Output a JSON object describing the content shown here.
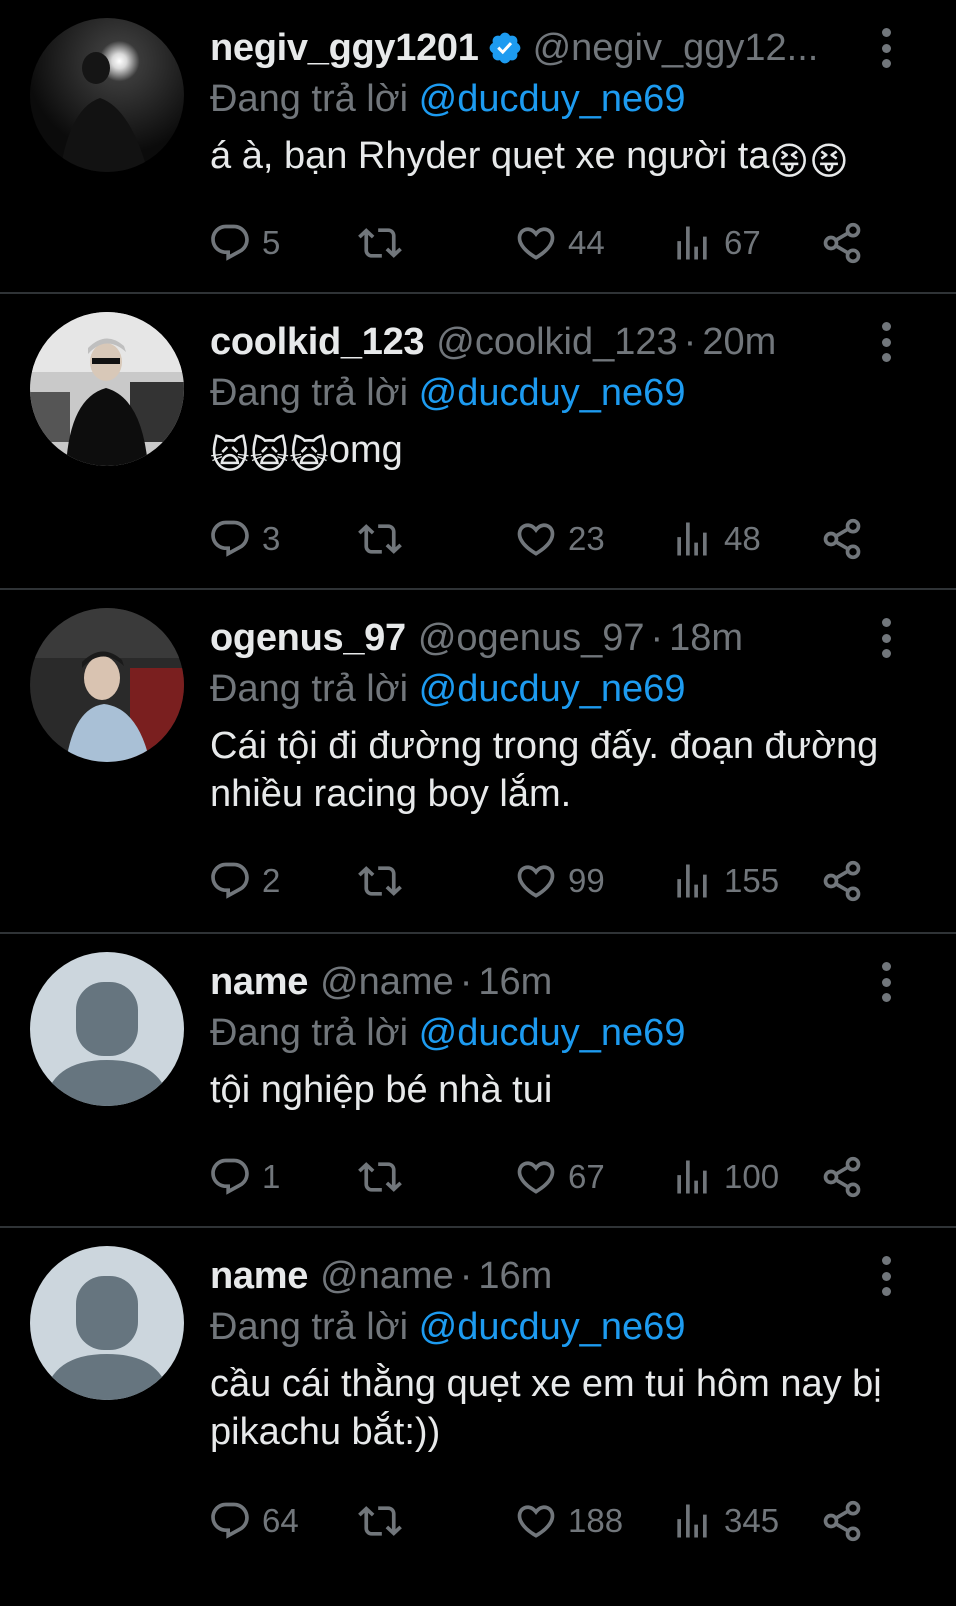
{
  "reply_prefix": "Đang trả lời",
  "tweets": [
    {
      "name": "negiv_ggy1201",
      "verified": true,
      "handle": "@negiv_ggy12...",
      "dot": "",
      "time": "",
      "mention": "@ducduy_ne69",
      "text": "á à, bạn Rhyder quẹt xe người ta",
      "emojis": [
        "😝",
        "😝"
      ],
      "replies": "5",
      "retweets": "",
      "likes": "44",
      "views": "67"
    },
    {
      "name": "coolkid_123",
      "verified": false,
      "handle": "@coolkid_123",
      "dot": "·",
      "time": "20m",
      "mention": "@ducduy_ne69",
      "text_prefix_emojis": [
        "🙀",
        "🙀",
        "🙀"
      ],
      "text": "omg",
      "replies": "3",
      "retweets": "",
      "likes": "23",
      "views": "48"
    },
    {
      "name": "ogenus_97",
      "verified": false,
      "handle": "@ogenus_97",
      "dot": "·",
      "time": "18m",
      "mention": "@ducduy_ne69",
      "text": "Cái tội đi đường trong đấy. đoạn đường nhiều racing boy lắm.",
      "replies": "2",
      "retweets": "",
      "likes": "99",
      "views": "155"
    },
    {
      "name": "name",
      "verified": false,
      "handle": "@name",
      "dot": "·",
      "time": "16m",
      "mention": "@ducduy_ne69",
      "text": "tội nghiệp bé nhà tui",
      "replies": "1",
      "retweets": "",
      "likes": "67",
      "views": "100"
    },
    {
      "name": "name",
      "verified": false,
      "handle": "@name",
      "dot": "·",
      "time": "16m",
      "mention": "@ducduy_ne69",
      "text": "cầu cái thằng quẹt xe em tui hôm nay bị pikachu bắt:))",
      "replies": "64",
      "retweets": "",
      "likes": "188",
      "views": "345"
    }
  ],
  "colors": {
    "background": "#000000",
    "text": "#e7e9ea",
    "muted": "#71767b",
    "accent": "#1d9bf0",
    "divider": "#2f3336",
    "default_avatar_bg": "#ccd6dd",
    "default_avatar_fg": "#66757f"
  }
}
